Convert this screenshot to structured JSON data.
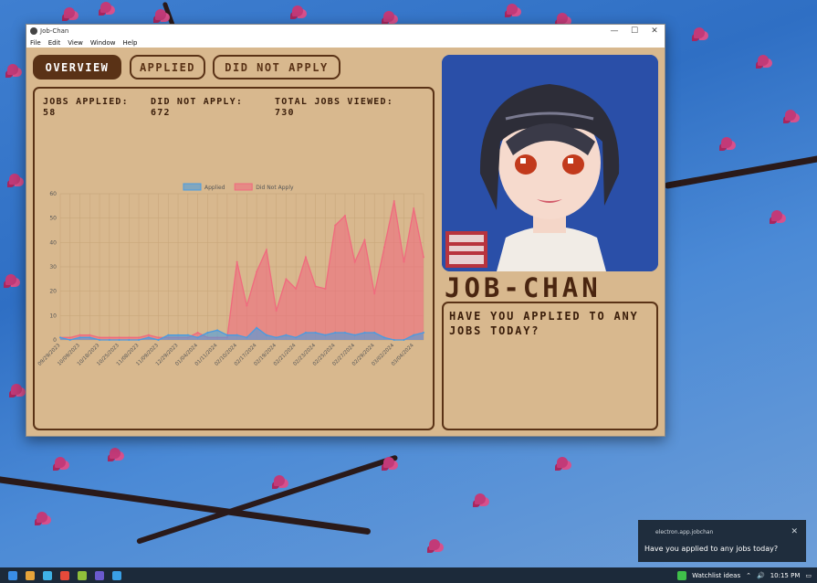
{
  "window": {
    "title": "Job-Chan",
    "menu": [
      "File",
      "Edit",
      "View",
      "Window",
      "Help"
    ],
    "controls": {
      "minimize": "—",
      "maximize": "☐",
      "close": "✕"
    }
  },
  "tabs": [
    {
      "label": "OVERVIEW",
      "active": true
    },
    {
      "label": "APPLIED",
      "active": false
    },
    {
      "label": "DID NOT APPLY",
      "active": false
    }
  ],
  "stats": [
    {
      "label": "JOBS APPLIED:",
      "value": "58"
    },
    {
      "label": "DID NOT APPLY:",
      "value": "672"
    },
    {
      "label": "TOTAL JOBS VIEWED:",
      "value": "730"
    }
  ],
  "character": {
    "name": "JOB-CHAN",
    "speech": "HAVE YOU APPLIED TO ANY JOBS TODAY?"
  },
  "chart_data": {
    "type": "area",
    "x": [
      "09/29/2023",
      "",
      "10/09/2023",
      "",
      "10/18/2023",
      "",
      "10/25/2023",
      "",
      "11/08/2023",
      "",
      "11/09/2023",
      "",
      "12/29/2023",
      "",
      "01/04/2024",
      "",
      "01/11/2024",
      "",
      "02/10/2024",
      "",
      "02/17/2024",
      "",
      "02/19/2024",
      "",
      "02/21/2024",
      "",
      "02/23/2024",
      "",
      "02/25/2024",
      "",
      "02/27/2024",
      "",
      "02/29/2024",
      "",
      "03/02/2024",
      "",
      "03/04/2024",
      ""
    ],
    "series": [
      {
        "name": "Applied",
        "color": "#4a9be0",
        "values": [
          1,
          0,
          1,
          1,
          0,
          0,
          0,
          0,
          0,
          1,
          0,
          2,
          2,
          2,
          1,
          3,
          4,
          2,
          2,
          1,
          5,
          2,
          1,
          2,
          1,
          3,
          3,
          2,
          3,
          3,
          2,
          3,
          3,
          1,
          0,
          0,
          2,
          3
        ]
      },
      {
        "name": "Did Not Apply",
        "color": "#f06a7e",
        "values": [
          1,
          1,
          2,
          2,
          1,
          1,
          1,
          1,
          1,
          2,
          1,
          1,
          1,
          1,
          3,
          1,
          1,
          1,
          32,
          14,
          28,
          37,
          12,
          25,
          21,
          34,
          22,
          21,
          47,
          51,
          32,
          41,
          19,
          38,
          57,
          32,
          54,
          34
        ]
      }
    ],
    "ylim": [
      0,
      60
    ],
    "yticks": [
      0,
      10,
      20,
      30,
      40,
      50,
      60
    ],
    "grid": true,
    "legend": "top-center"
  },
  "desktop": {
    "taskbar": {
      "watchlist": "Watchlist ideas",
      "time": "10:15 PM"
    },
    "notification": {
      "source": "electron.app.jobchan",
      "message": "Have you applied to any jobs today?",
      "close": "✕"
    }
  }
}
